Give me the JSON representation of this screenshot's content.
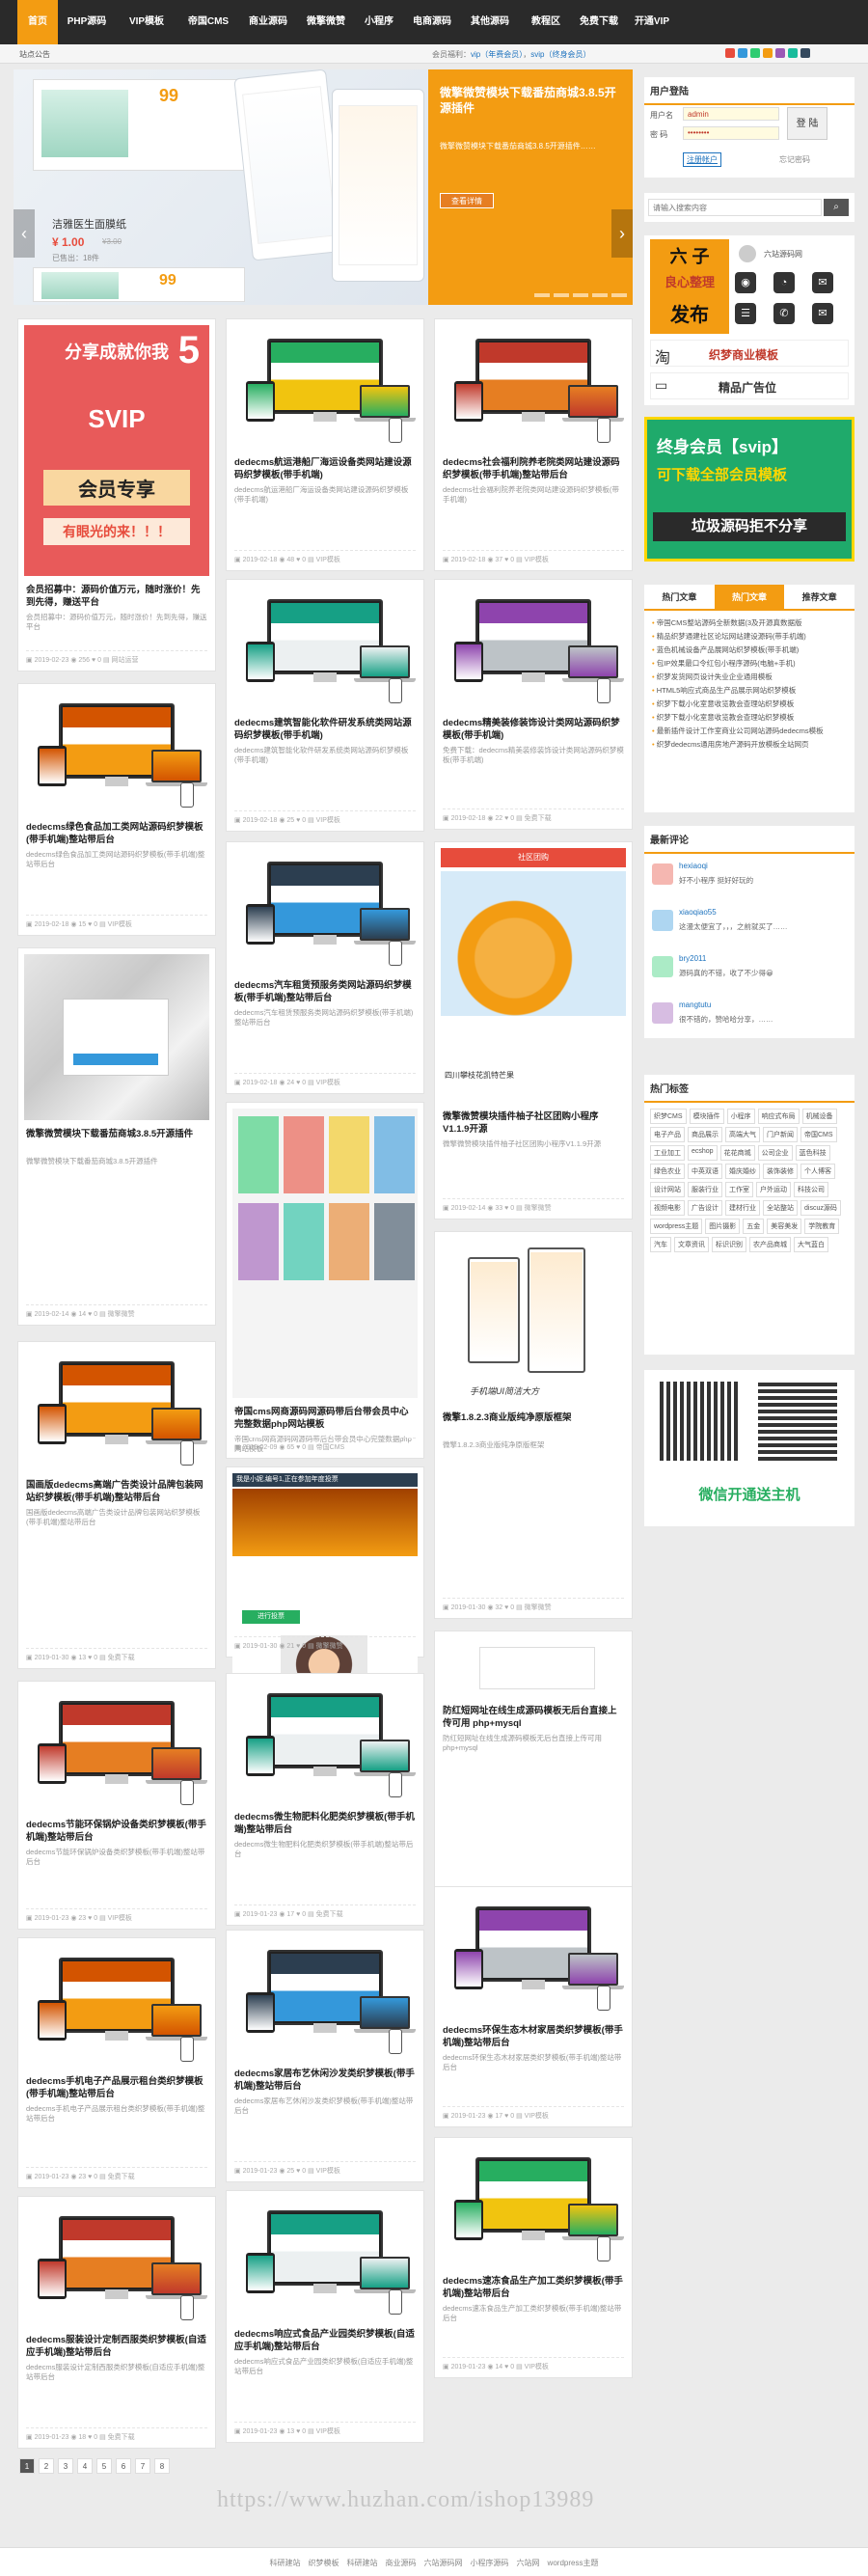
{
  "nav": {
    "items": [
      {
        "label": "首页",
        "active": true
      },
      {
        "label": "PHP源码"
      },
      {
        "label": "VIP模板",
        "hot": "HOT"
      },
      {
        "label": "帝国CMS"
      },
      {
        "label": "商业源码",
        "hot": "HOT"
      },
      {
        "label": "微擎微赞"
      },
      {
        "label": "小程序"
      },
      {
        "label": "电商源码"
      },
      {
        "label": "其他源码"
      },
      {
        "label": "教程区"
      },
      {
        "label": "免费下载"
      },
      {
        "label": "开通VIP"
      }
    ]
  },
  "subbar": {
    "left": "站点公告",
    "notice_prefix": "会员福利：",
    "notice_vip": "vip（年费会员）",
    "notice_sep": "，",
    "notice_svip": "svip（终身会员）"
  },
  "slider": {
    "caption": "洁雅医生面膜纸",
    "price": "¥ 1.00",
    "old_price": "¥3.00",
    "sold": "已售出：18件",
    "coupon": "99",
    "coupon2": "99",
    "promo_title": "微擎微赞模块下载番茄商城3.8.5开源插件",
    "promo_desc": "微擎微赞模块下载番茄商城3.8.5开源插件……",
    "promo_btn": "查看详情"
  },
  "user_panel": {
    "title": "用户登陆",
    "user_label": "用户名",
    "user_value": "admin",
    "pass_label": "密 码",
    "pass_value": "••••••••",
    "login_btn": "登 陆",
    "register": "注册帐户",
    "forgot": "忘记密码"
  },
  "search": {
    "placeholder": "请输入搜索内容"
  },
  "ad_box": {
    "tile1_a": "六",
    "tile1_b": "子",
    "tile2_a": "良心整理",
    "tile2_b": "发布",
    "site": "六站源码网",
    "banner": "织梦商业模板",
    "banner2": "精品广告位"
  },
  "svip_ad": {
    "line1": "终身会员【svip】",
    "line2": "可下载全部会员模板",
    "line3": "垃圾源码拒不分享"
  },
  "tabs": {
    "t1": "热门文章",
    "t2": "热门文章",
    "t3": "推荐文章"
  },
  "hot_list": [
    "帝国CMS整站源码全新数据(3及开源真数据版",
    "精品织梦通建社区论坛网站建设源码(带手机端)",
    "蓝色机械设备产品展网站织梦模板(带手机端)",
    "包IP效果最口令红包小程序源码(电脑+手机)",
    "织梦发货网页设计失业企业通用模板",
    "HTML5响应式商品生产品展示网站织梦模板",
    "织梦下载小化室意收览教会查理站织梦模板",
    "织梦下载小化室意收览教会查理站织梦模板",
    "最新插件设计工作室商业公司网站源码dedecms模板",
    "织梦dedecms通用房地产源码开放模板全站网页"
  ],
  "comments_title": "最新评论",
  "comments": [
    {
      "user": "hexiaoqi",
      "text": "好不小程序  挺好好玩的"
    },
    {
      "user": "xiaoqiao55",
      "text": "这漫太便宜了，，，之前就买了……"
    },
    {
      "user": "bry2011",
      "text": "源码真的不错，收了不少得😀"
    },
    {
      "user": "mangtutu",
      "text": "很不错的，赞哈哈分享，……"
    }
  ],
  "tags_title": "热门标签",
  "tags": [
    "织梦CMS",
    "模块插件",
    "小程序",
    "响应式布局",
    "机械设备",
    "电子产品",
    "商品展示",
    "高端大气",
    "门户新闻",
    "帝国CMS",
    "工业加工",
    "ecshop",
    "花花商城",
    "公司企业",
    "蓝色科技",
    "绿色农业",
    "中英双语",
    "婚庆婚纱",
    "装饰装修",
    "个人博客",
    "设计网站",
    "服装行业",
    "工作室",
    "户外运动",
    "科技公司",
    "视频电影",
    "广告设计",
    "建材行业",
    "全站整站",
    "discuz源码",
    "wordpress主题",
    "图片摄影",
    "五金",
    "美容美发",
    "学院教育",
    "汽车",
    "文章资讯",
    "标识识别",
    "农产品商城",
    "大气蓝白"
  ],
  "qr": {
    "caption": "微信开通送主机"
  },
  "cards": [
    {
      "title": "会员招募中：源码价值万元，随时涨价！先到先得，赚送平台",
      "desc": "会员招募中：源码价值万元，随时涨价！先到先得，赚送平台",
      "date": "2019-02-23",
      "views": "256",
      "likes": "0",
      "cat": "网站运营",
      "poster_l1": "分享成就你我",
      "poster_num": "5",
      "poster_l2": "SVIP",
      "poster_l3": "会员专享",
      "poster_l4": "有眼光的来！！！"
    },
    {
      "title": "dedecms航运港船厂海运设备类网站建设源码织梦模板(带手机端)",
      "desc": "dedecms航运港船厂海运设备类网站建设源码织梦模板(带手机端)",
      "date": "2019-02-18",
      "views": "48",
      "likes": "0",
      "cat": "VIP模板"
    },
    {
      "title": "dedecms社会福利院养老院类网站建设源码织梦模板(带手机端)整站带后台",
      "desc": "dedecms社会福利院养老院类网站建设源码织梦模板(带手机端)",
      "date": "2019-02-18",
      "views": "37",
      "likes": "0",
      "cat": "VIP模板"
    },
    {
      "title": "dedecms建筑智能化软件研发系统类网站源码织梦模板(带手机端)",
      "desc": "dedecms建筑智能化软件研发系统类网站源码织梦模板(带手机端)",
      "date": "2019-02-18",
      "views": "25",
      "likes": "0",
      "cat": "VIP模板"
    },
    {
      "title": "dedecms精美装修装饰设计类网站源码织梦模板(带手机端)",
      "desc": "免费下载：dedecms精美装修装饰设计类网站源码织梦模板(带手机端)",
      "date": "2019-02-18",
      "views": "22",
      "likes": "0",
      "cat": "免费下载"
    },
    {
      "title": "dedecms绿色食品加工类网站源码织梦模板(带手机端)整站带后台",
      "desc": "dedecms绿色食品加工类网站源码织梦模板(带手机端)整站带后台",
      "date": "2019-02-18",
      "views": "15",
      "likes": "0",
      "cat": "VIP模板"
    },
    {
      "title": "dedecms汽车租赁预服务类网站源码织梦模板(带手机端)整站带后台",
      "desc": "dedecms汽车租赁预服务类网站源码织梦模板(带手机端)整站带后台",
      "date": "2019-02-18",
      "views": "24",
      "likes": "0",
      "cat": "VIP模板"
    },
    {
      "title": "微擎微赞模块插件柚子社区团购小程序V1.1.9开源",
      "desc": "微擎微赞模块插件柚子社区团购小程序V1.1.9开源",
      "date": "2019-02-14",
      "views": "33",
      "likes": "0",
      "cat": "微擎微赞",
      "shop_title": "社区团购",
      "shop_name": "四川攀枝花凯特芒果"
    },
    {
      "title": "微擎微赞模块下载番茄商城3.8.5开源插件",
      "desc": "微擎微赞模块下载番茄商城3.8.5开源插件",
      "date": "2019-02-14",
      "views": "14",
      "likes": "0",
      "cat": "微擎微赞",
      "phone_text": "手机端UI简洁大方"
    },
    {
      "title": "帝国cms网商源码网源码带后台带会员中心完整数据php网站模板",
      "desc": "帝国cms网商源码网源码带后台带会员中心完整数据php网站模板",
      "date": "2019-02-09",
      "views": "65",
      "likes": "0",
      "cat": "帝国CMS"
    },
    {
      "title": "微擎1.8.2.3商业版纯净原版框架",
      "desc": "微擎1.8.2.3商业版纯净原版框架",
      "date": "2019-01-30",
      "views": "32",
      "likes": "0",
      "cat": "微擎微赞"
    },
    {
      "title": "国画版dedecms高端广告类设计品牌包装网站织梦模板(带手机端)整站带后台",
      "desc": "国画版dedecms高端广告类设计品牌包装网站织梦模板(带手机端)整站带后台",
      "date": "2019-01-30",
      "views": "13",
      "likes": "0",
      "cat": "免费下载"
    },
    {
      "title": "微擎微赞模块插件 钻石投票5.40开源版",
      "desc": "微擎微赞模块插件 钻石投票5.40开源版",
      "date": "2019-01-30",
      "views": "21",
      "likes": "0",
      "cat": "微擎微赞",
      "vote_title": "我是小妮,编号1,正在参加年度投票",
      "vote_btn": "进行投票"
    },
    {
      "title": "dedecms节能环保锅炉设备类织梦模板(带手机端)整站带后台",
      "desc": "dedecms节能环保锅炉设备类织梦模板(带手机端)整站带后台",
      "date": "2019-01-23",
      "views": "23",
      "likes": "0",
      "cat": "VIP模板"
    },
    {
      "title": "dedecms微生物肥料化肥类织梦模板(带手机端)整站带后台",
      "desc": "dedecms微生物肥料化肥类织梦模板(带手机端)整站带后台",
      "date": "2019-01-23",
      "views": "17",
      "likes": "0",
      "cat": "免费下载"
    },
    {
      "title": "防红短网址在线生成源码模板无后台直接上传可用 php+mysql",
      "desc": "防红短网址在线生成源码模板无后台直接上传可用 php+mysql",
      "date": "2019-01-30",
      "views": "22",
      "likes": "0",
      "cat": "其他源码"
    },
    {
      "title": "dedecms手机电子产品展示租台类织梦模板(带手机端)整站带后台",
      "desc": "dedecms手机电子产品展示租台类织梦模板(带手机端)整站带后台",
      "date": "2019-01-23",
      "views": "23",
      "likes": "0",
      "cat": "免费下载"
    },
    {
      "title": "dedecms家居布艺休闲沙发类织梦模板(带手机端)整站带后台",
      "desc": "dedecms家居布艺休闲沙发类织梦模板(带手机端)整站带后台",
      "date": "2019-01-23",
      "views": "25",
      "likes": "0",
      "cat": "VIP模板"
    },
    {
      "title": "dedecms环保生态木材家居类织梦模板(带手机端)整站带后台",
      "desc": "dedecms环保生态木材家居类织梦模板(带手机端)整站带后台",
      "date": "2019-01-23",
      "views": "17",
      "likes": "0",
      "cat": "VIP模板"
    },
    {
      "title": "dedecms服装设计定制西服类织梦模板(自适应手机端)整站带后台",
      "desc": "dedecms服装设计定制西服类织梦模板(自适应手机端)整站带后台",
      "date": "2019-01-23",
      "views": "18",
      "likes": "0",
      "cat": "免费下载"
    },
    {
      "title": "dedecms响应式食品产业园类织梦模板(自适应手机端)整站带后台",
      "desc": "dedecms响应式食品产业园类织梦模板(自适应手机端)整站带后台",
      "date": "2019-01-23",
      "views": "13",
      "likes": "0",
      "cat": "VIP模板"
    },
    {
      "title": "dedecms速冻食品生产加工类织梦模板(带手机端)整站带后台",
      "desc": "dedecms速冻食品生产加工类织梦模板(带手机端)整站带后台",
      "date": "2019-01-23",
      "views": "14",
      "likes": "0",
      "cat": "VIP模板"
    }
  ],
  "pager": [
    "1",
    "2",
    "3",
    "4",
    "5",
    "6",
    "7",
    "8"
  ],
  "watermark": "https://www.huzhan.com/ishop13989",
  "footer": [
    "科研建站",
    "织梦模板",
    "科研建站",
    "商业源码",
    "六站源码网",
    "小程序源码",
    "六站网",
    "wordpress主题"
  ],
  "colors": {
    "accent": "#f39c12",
    "dark": "#2a2a2a",
    "red": "#e74c3c"
  }
}
